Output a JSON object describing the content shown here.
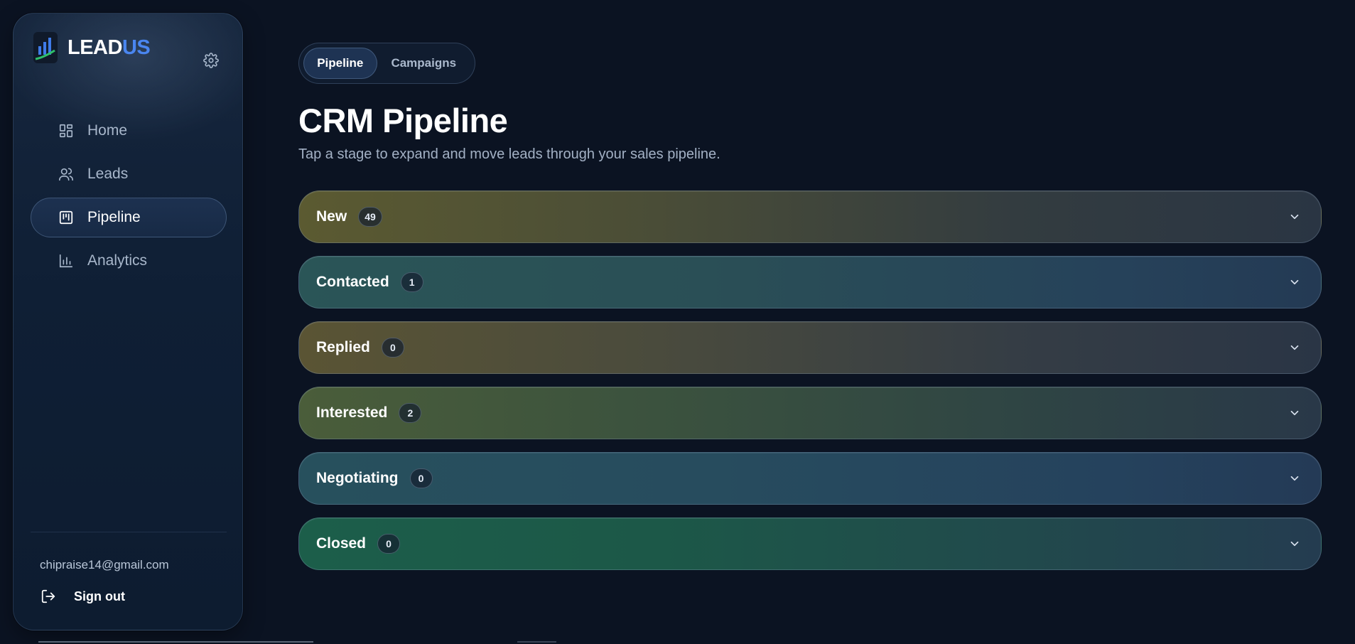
{
  "brand": {
    "name_part1": "LEAD",
    "name_part2": "US",
    "accent": "#4a86f0",
    "logo_icon": "bar-chart-logo-icon"
  },
  "sidebar": {
    "settings_icon": "gear-icon",
    "items": [
      {
        "label": "Home",
        "icon": "grid-icon",
        "active": false
      },
      {
        "label": "Leads",
        "icon": "users-icon",
        "active": false
      },
      {
        "label": "Pipeline",
        "icon": "kanban-icon",
        "active": true
      },
      {
        "label": "Analytics",
        "icon": "bar-chart-icon",
        "active": false
      }
    ],
    "user_email": "chipraise14@gmail.com",
    "signout_label": "Sign out",
    "signout_icon": "logout-icon"
  },
  "tabs": [
    {
      "label": "Pipeline",
      "active": true
    },
    {
      "label": "Campaigns",
      "active": false
    }
  ],
  "page": {
    "title": "CRM Pipeline",
    "subtitle": "Tap a stage to expand and move leads through your sales pipeline."
  },
  "stages": [
    {
      "label": "New",
      "count": "49"
    },
    {
      "label": "Contacted",
      "count": "1"
    },
    {
      "label": "Replied",
      "count": "0"
    },
    {
      "label": "Interested",
      "count": "2"
    },
    {
      "label": "Negotiating",
      "count": "0"
    },
    {
      "label": "Closed",
      "count": "0"
    }
  ],
  "colors": {
    "background": "#0b1322",
    "sidebar": "#0f1f35",
    "text_primary": "#ffffff",
    "text_muted": "#a3b1c5"
  }
}
